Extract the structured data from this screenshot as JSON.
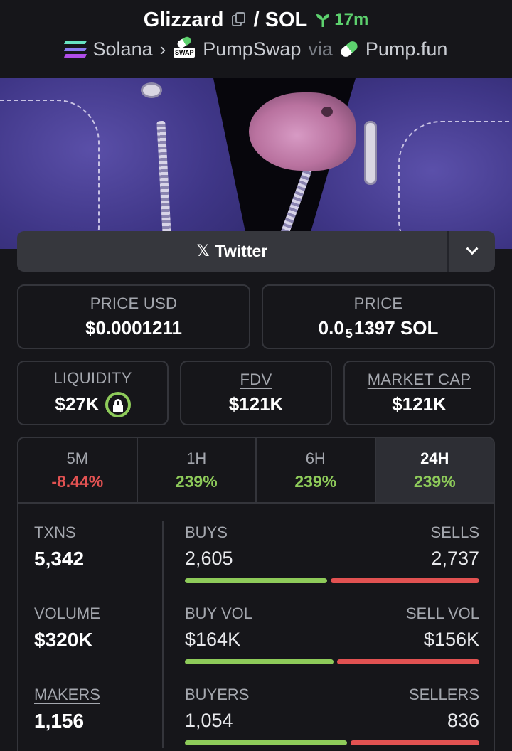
{
  "header": {
    "token_name": "Glizzard",
    "pair_separator": "/ SOL",
    "age": "17m",
    "chain": "Solana",
    "dex": "PumpSwap",
    "via": "via",
    "launchpad": "Pump.fun",
    "swap_tag": "SWAP"
  },
  "links": {
    "twitter_label": "Twitter"
  },
  "stats": {
    "price_usd_label": "PRICE USD",
    "price_usd": "$0.0001211",
    "price_label": "PRICE",
    "price_prefix": "0.0",
    "price_zeros": "5",
    "price_suffix": "1397 SOL",
    "liquidity_label": "LIQUIDITY",
    "liquidity": "$27K",
    "fdv_label": "FDV",
    "fdv": "$121K",
    "mcap_label": "MARKET CAP",
    "mcap": "$121K"
  },
  "timeframes": [
    {
      "label": "5M",
      "change": "-8.44%",
      "color": "#e25252"
    },
    {
      "label": "1H",
      "change": "239%",
      "color": "#8ecb5a"
    },
    {
      "label": "6H",
      "change": "239%",
      "color": "#8ecb5a"
    },
    {
      "label": "24H",
      "change": "239%",
      "color": "#8ecb5a",
      "active": true
    }
  ],
  "metrics": {
    "txns_label": "TXNS",
    "txns": "5,342",
    "volume_label": "VOLUME",
    "volume": "$320K",
    "makers_label": "MAKERS",
    "makers": "1,156",
    "buys_label": "BUYS",
    "buys": "2,605",
    "sells_label": "SELLS",
    "sells": "2,737",
    "buy_vol_label": "BUY VOL",
    "buy_vol": "$164K",
    "sell_vol_label": "SELL VOL",
    "sell_vol": "$156K",
    "buyers_label": "BUYERS",
    "buyers": "1,054",
    "sellers_label": "SELLERS",
    "sellers": "836",
    "buy_ratio": 0.488,
    "buy_vol_ratio": 0.512,
    "buyer_ratio": 0.558
  },
  "colors": {
    "positive": "#8ecb5a",
    "negative": "#e25252",
    "age": "#5dd16e"
  }
}
